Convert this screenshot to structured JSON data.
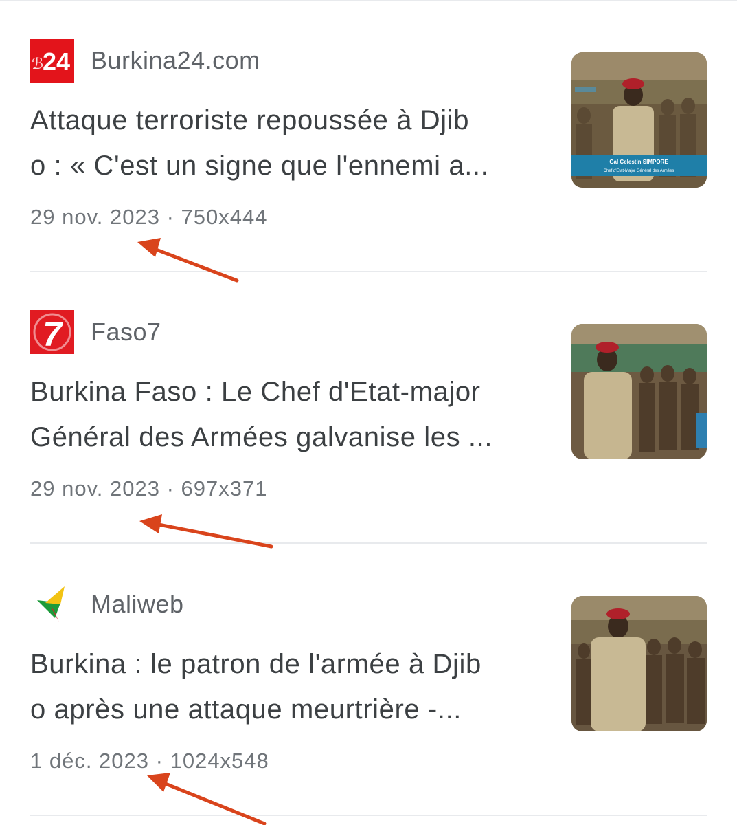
{
  "results": [
    {
      "source": "Burkina24.com",
      "favicon": "burkina24-logo",
      "favicon_text": "B24",
      "title_line1": "Attaque terroriste repoussée à Djib",
      "title_line2": "o : « C'est un signe que l'ennemi a...",
      "date": "29 nov. 2023",
      "separator": " · ",
      "size": "750x444",
      "thumbnail": "soldiers-photo",
      "caption_name": "Gal Celestin SIMPORE",
      "caption_role": "Chef d'Etat-Major Général des Armées"
    },
    {
      "source": "Faso7",
      "favicon": "faso7-logo",
      "favicon_text": "7",
      "title_line1": "Burkina Faso : Le Chef d'Etat-major",
      "title_line2": "Général des Armées galvanise les ...",
      "date": "29 nov. 2023",
      "separator": " · ",
      "size": "697x371",
      "thumbnail": "soldiers-photo"
    },
    {
      "source": "Maliweb",
      "favicon": "maliweb-logo",
      "title_line1": "Burkina : le patron de l'armée à Djib",
      "title_line2": "o après une attaque meurtrière -...",
      "date": "1 déc. 2023",
      "separator": " · ",
      "size": "1024x548",
      "thumbnail": "soldiers-photo"
    }
  ],
  "colors": {
    "burkina24_red": "#e3141b",
    "faso7_red": "#e11b22",
    "arrow": "#d9441c",
    "beret": "#b0202a"
  }
}
